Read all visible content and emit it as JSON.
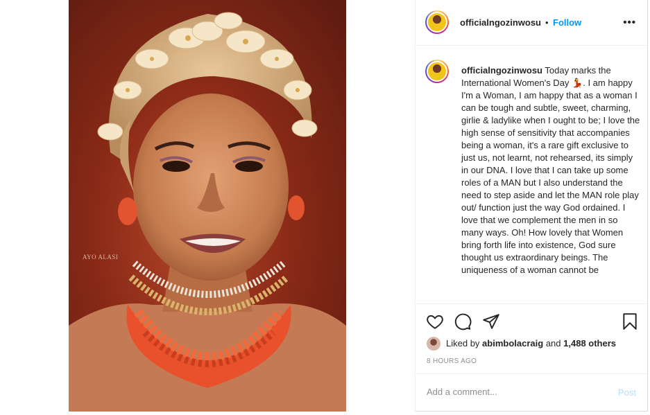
{
  "post": {
    "photo_watermark": "AYO ALASI",
    "header": {
      "username": "officialngozinwosu",
      "separator": "•",
      "follow_label": "Follow",
      "more_icon": "more-horizontal-icon"
    },
    "caption": {
      "username": "officialngozinwosu",
      "text": " Today marks the International Women's Day 💃. I am happy I'm a Woman, I am happy that as a woman I can be tough and subtle, sweet, charming, girlie & ladylike when I ought to be; I love the high sense of sensitivity that accompanies being a woman, it's a rare gift exclusive to just us, not learnt, not rehearsed, its simply in our DNA. I love that I can take up some roles of a MAN but I also understand the need to step aside and let the MAN role play out/ function just the way God ordained. I love that we complement the men in so many ways. Oh! How lovely that Women bring forth life into existence, God sure thought us extraordinary beings. The uniqueness of a woman cannot be"
    },
    "actions": {
      "icons": [
        "heart-icon",
        "comment-icon",
        "share-icon",
        "bookmark-icon"
      ]
    },
    "likes": {
      "prefix": "Liked by",
      "user": "abimbolacraig",
      "conjunction": "and",
      "others": "1,488 others"
    },
    "time_ago": "8 HOURS AGO",
    "comment": {
      "placeholder": "Add a comment...",
      "post_label": "Post"
    },
    "colors": {
      "link_blue": "#0095f6",
      "post_disabled": "#b2dffc",
      "muted": "#8e8e8e"
    }
  }
}
